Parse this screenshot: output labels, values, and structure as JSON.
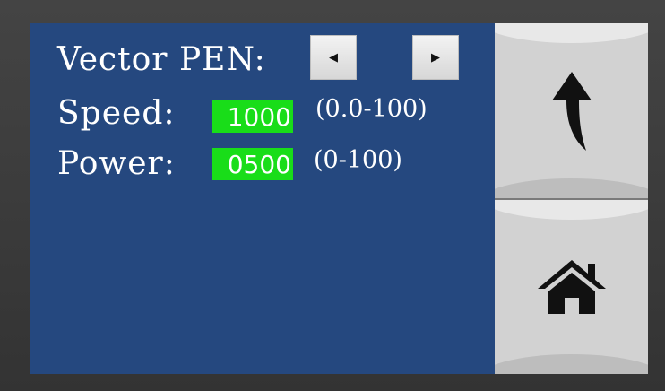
{
  "vector_pen": {
    "label": "Vector PEN:",
    "prev_icon": "left-triangle-icon",
    "next_icon": "right-triangle-icon",
    "prev_glyph": "◀",
    "next_glyph": "▶"
  },
  "speed": {
    "label": "Speed:",
    "value": "1000",
    "range": "(0.0-100)"
  },
  "power": {
    "label": "Power:",
    "value": "0500",
    "range": "(0-100)"
  },
  "side": {
    "back_icon": "back-arrow-icon",
    "home_icon": "home-icon"
  },
  "colors": {
    "panel": "#25487f",
    "value_box": "#19dd19",
    "side": "#d2d2d2"
  }
}
